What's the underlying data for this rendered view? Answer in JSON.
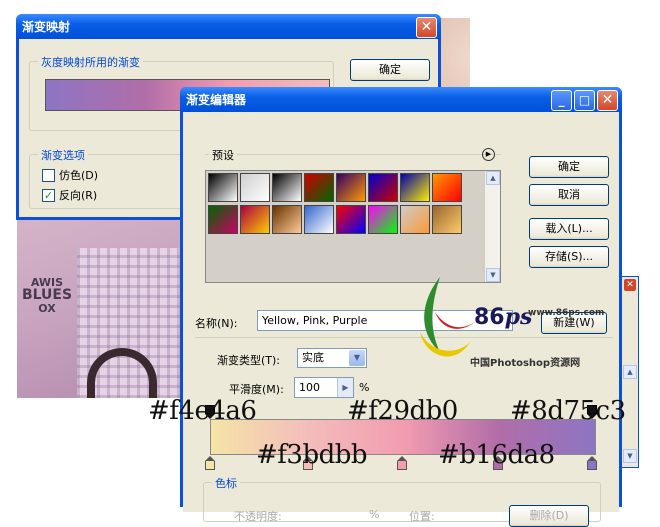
{
  "photo": {
    "print_text": [
      "AWIS",
      "BLUES",
      "OX"
    ]
  },
  "gradient_map_dialog": {
    "title": "渐变映射",
    "group_gradient_label": "灰度映射所用的渐变",
    "ok_button": "确定",
    "group_options_label": "渐变选项",
    "dither_label": "仿色(D)",
    "reverse_label": "反向(R)",
    "dither_checked": false,
    "reverse_checked": true
  },
  "gradient_editor": {
    "title": "渐变编辑器",
    "presets_label": "预设",
    "buttons": {
      "ok": "确定",
      "cancel": "取消",
      "load": "载入(L)...",
      "save": "存储(S)...",
      "new": "新建(W)"
    },
    "name_label": "名称(N):",
    "name_value": "Yellow, Pink, Purple",
    "type_label": "渐变类型(T):",
    "type_value": "实底",
    "smoothness_label": "平滑度(M):",
    "smoothness_value": "100",
    "smoothness_unit": "%",
    "color_stops_label": "色标",
    "opacity_label": "不透明度:",
    "location_label": "位置:",
    "delete_button": "删除(D)",
    "unit_percent": "%",
    "presets_colors": [
      [
        "#000000",
        "#ffffff"
      ],
      [
        "#cfcfcf",
        "#ffffff"
      ],
      [
        "#000000",
        "#ffffff"
      ],
      [
        "#cc0000",
        "#006600"
      ],
      [
        "#330066",
        "#ff9900"
      ],
      [
        "#0000cc",
        "#cc0000"
      ],
      [
        "#0000aa",
        "#ffee00"
      ],
      [
        "#ff9900",
        "#ff0000"
      ],
      [
        "#006600",
        "#cc0066"
      ],
      [
        "#aa0044",
        "#ffcc00"
      ],
      [
        "#663300",
        "#ffcc99"
      ],
      [
        "#3366cc",
        "#ffffff"
      ],
      [
        "#ff0000",
        "#0000ff"
      ],
      [
        "#ff00ff",
        "#00ff00"
      ],
      [
        "#cccccc",
        "#ff9933"
      ],
      [
        "#996633",
        "#ffcc66"
      ]
    ],
    "gradient_colors": [
      "#f4e4a6",
      "#f3bdbb",
      "#f29db0",
      "#b16da8",
      "#8d75c3"
    ]
  },
  "annotations": {
    "hex_top": [
      "#f4e4a6",
      "#f29db0",
      "#8d75c3"
    ],
    "hex_bottom": [
      "#f3bdbb",
      "#b16da8"
    ]
  },
  "watermark": {
    "number": "86",
    "letter": "ps",
    "url": "www.86ps.com",
    "cn_text": "中国Photoshop资源网"
  }
}
